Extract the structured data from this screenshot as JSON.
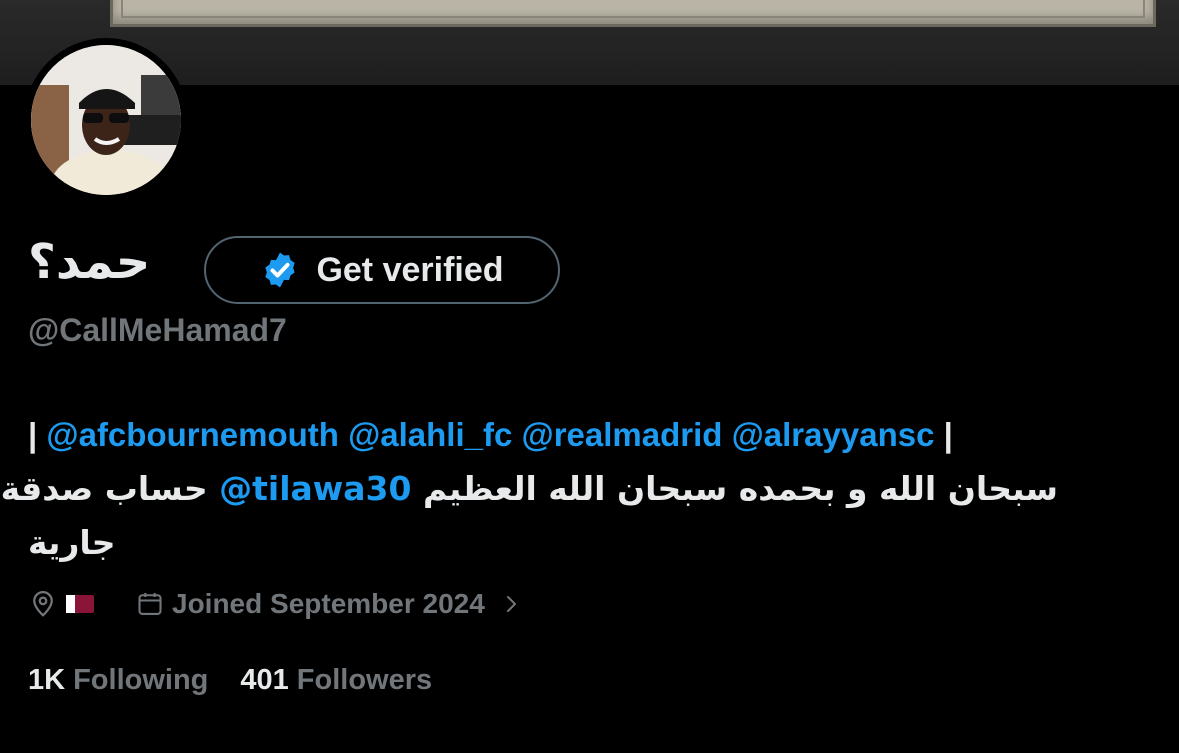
{
  "profile": {
    "display_name": "حمد؟",
    "handle": "@CallMeHamad7",
    "verify_label": "Get verified"
  },
  "bio": {
    "pipe_open": "| ",
    "mentions": [
      "@afcbournemouth",
      "@alahli_fc",
      "@realmadrid",
      "@alrayyansc"
    ],
    "pipe_close": " |",
    "line2_text": "سبحان الله و بحمده سبحان الله العظيم ",
    "line2_mention": "@tilawa30",
    "line2_tail": " حساب صدقة",
    "line3": "جارية"
  },
  "meta": {
    "location_icon": "location-pin-icon",
    "location_flag": "qatar-flag",
    "calendar_icon": "calendar-icon",
    "joined": "Joined September 2024",
    "chevron_icon": "chevron-right-icon"
  },
  "stats": {
    "following_count": "1K",
    "following_label": "Following",
    "followers_count": "401",
    "followers_label": "Followers"
  },
  "colors": {
    "background": "#000000",
    "text": "#e7e9ea",
    "muted": "#71767b",
    "accent": "#1d9bf0",
    "border": "#536471"
  }
}
